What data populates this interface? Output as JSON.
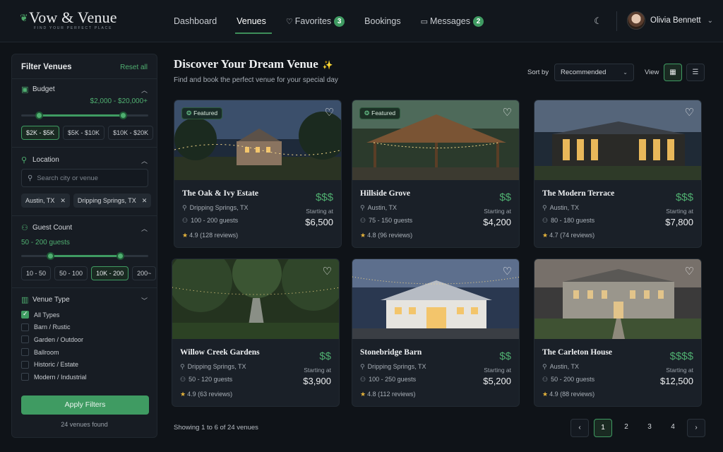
{
  "brand": {
    "name": "Vow & Venue",
    "tagline": "FIND YOUR PERFECT PLACE"
  },
  "nav": {
    "links": [
      {
        "label": "Dashboard",
        "active": false
      },
      {
        "label": "Venues",
        "active": true
      },
      {
        "label": "Favorites",
        "badge": "3",
        "icon": "heart-icon"
      },
      {
        "label": "Bookings"
      },
      {
        "label": "Messages",
        "badge": "2",
        "icon": "message-icon"
      }
    ],
    "user": "Olivia Bennett"
  },
  "filters": {
    "title": "Filter Venues",
    "reset": "Reset all",
    "budget": {
      "title": "Budget",
      "range": "$2,000 - $20,000+",
      "min_fraction": 0.14,
      "max_fraction": 0.8,
      "chips": [
        "$2K - $5K",
        "$5K - $10K",
        "$10K - $20K"
      ]
    },
    "location": {
      "title": "Location",
      "placeholder": "Search city or venue",
      "tags": [
        "Austin, TX",
        "Dripping Springs, TX"
      ]
    },
    "guests": {
      "title": "Guest Count",
      "range": "50 - 200 guests",
      "min_fraction": 0.23,
      "max_fraction": 0.78,
      "chips": [
        "10 - 50",
        "50 - 100",
        "10K - 200",
        "200~"
      ]
    },
    "venue_type": {
      "title": "Venue Type",
      "options": [
        {
          "label": "All Types",
          "checked": true
        },
        {
          "label": "Barn / Rustic",
          "checked": false
        },
        {
          "label": "Garden / Outdoor",
          "checked": false
        },
        {
          "label": "Ballroom",
          "checked": false
        },
        {
          "label": "Historic / Estate",
          "checked": false
        },
        {
          "label": "Modern / Industrial",
          "checked": false
        }
      ]
    },
    "apply": "Apply Filters",
    "found": "24 venues found"
  },
  "main": {
    "title": "Discover Your Dream Venue",
    "subtitle": "Find and book the perfect venue for your special day",
    "sort_label": "Sort by",
    "sort_value": "Recommended",
    "view_label": "View",
    "starting_label": "Starting at",
    "featured_label": "Featured",
    "showing": "Showing 1 to 6 of 24 venues",
    "pages": [
      "1",
      "2",
      "3",
      "4"
    ]
  },
  "venues": [
    {
      "name": "The Oak & Ivy Estate",
      "location": "Dripping Springs, TX",
      "guests": "100 - 200 guests",
      "rating": "4.9",
      "reviews": "(128 reviews)",
      "tier": "$$$",
      "price": "$6,500",
      "featured": true,
      "scene": "estate"
    },
    {
      "name": "Hillside Grove",
      "location": "Austin, TX",
      "guests": "75 - 150 guests",
      "rating": "4.8",
      "reviews": "(96 reviews)",
      "tier": "$$",
      "price": "$4,200",
      "featured": true,
      "scene": "pavilion"
    },
    {
      "name": "The Modern Terrace",
      "location": "Austin, TX",
      "guests": "80 - 180 guests",
      "rating": "4.7",
      "reviews": "(74 reviews)",
      "tier": "$$$",
      "price": "$7,800",
      "featured": false,
      "scene": "terrace"
    },
    {
      "name": "Willow Creek Gardens",
      "location": "Dripping Springs, TX",
      "guests": "50 - 120 guests",
      "rating": "4.9",
      "reviews": "(63 reviews)",
      "tier": "$$",
      "price": "$3,900",
      "featured": false,
      "scene": "garden"
    },
    {
      "name": "Stonebridge Barn",
      "location": "Dripping Springs, TX",
      "guests": "100 - 250 guests",
      "rating": "4.8",
      "reviews": "(112 reviews)",
      "tier": "$$",
      "price": "$5,200",
      "featured": false,
      "scene": "barn"
    },
    {
      "name": "The Carleton House",
      "location": "Austin, TX",
      "guests": "50 - 200 guests",
      "rating": "4.9",
      "reviews": "(88 reviews)",
      "tier": "$$$$",
      "price": "$12,500",
      "featured": false,
      "scene": "mansion"
    }
  ]
}
